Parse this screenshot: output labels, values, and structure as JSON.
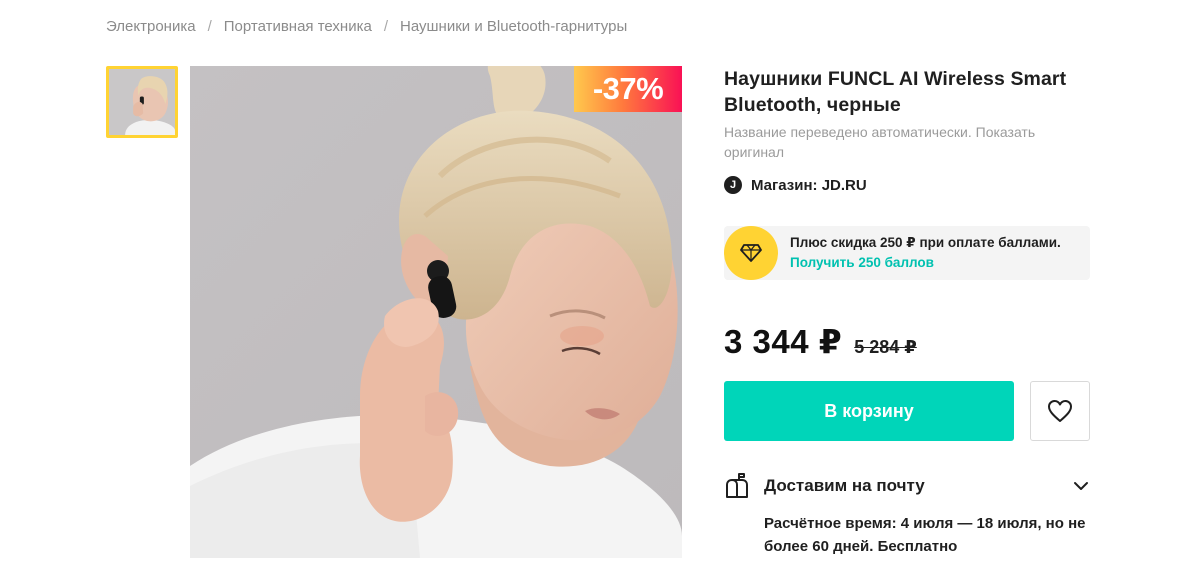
{
  "breadcrumb": {
    "items": [
      "Электроника",
      "Портативная техника",
      "Наушники и Bluetooth-гарнитуры"
    ],
    "separator": "/"
  },
  "product": {
    "title": "Наушники FUNCL AI Wireless Smart Bluetooth, черные",
    "translation_note": "Название переведено автоматически.",
    "show_original_label": "Показать оригинал",
    "discount_badge": "-37%",
    "shop_logo_letter": "J",
    "shop_label": "Магазин: JD.RU"
  },
  "plus_offer": {
    "line1": "Плюс скидка 250 ₽ при оплате баллами.",
    "line2": "Получить 250 баллов",
    "icon": "diamond-icon"
  },
  "pricing": {
    "price": "3 344 ₽",
    "old_price": "5 284 ₽"
  },
  "actions": {
    "cart_label": "В корзину",
    "favorite_icon": "heart-icon"
  },
  "delivery": {
    "title": "Доставим на почту",
    "text": "Расчётное время: 4 июля — 18 июля, но не более 60 дней. Бесплатно",
    "icon": "mailbox-icon",
    "expand_icon": "chevron-down-icon"
  },
  "colors": {
    "accent_teal": "#00d5b9",
    "link_teal": "#00c1b0",
    "plus_yellow": "#ffd333",
    "badge_gradient": [
      "#ffc94d",
      "#f91155"
    ]
  }
}
